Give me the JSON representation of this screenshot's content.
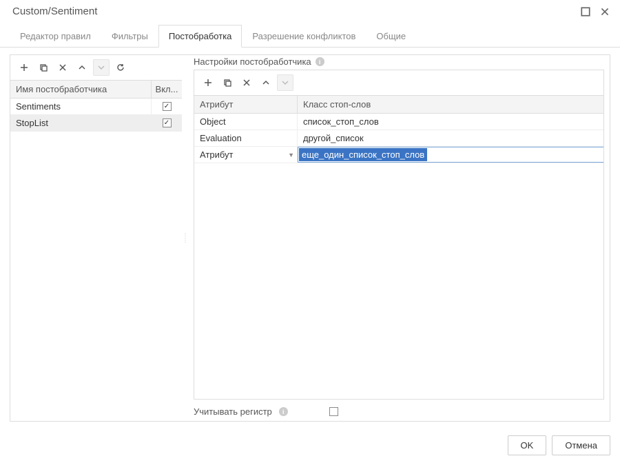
{
  "title": "Custom/Sentiment",
  "tabs": [
    {
      "label": "Редактор правил",
      "active": false
    },
    {
      "label": "Фильтры",
      "active": false
    },
    {
      "label": "Постобработка",
      "active": true
    },
    {
      "label": "Разрешение конфликтов",
      "active": false
    },
    {
      "label": "Общие",
      "active": false
    }
  ],
  "left_toolbar_icons": [
    "plus",
    "copy",
    "delete",
    "up",
    "down",
    "refresh"
  ],
  "left_grid": {
    "headers": {
      "name": "Имя постобработчика",
      "enabled": "Вкл..."
    },
    "rows": [
      {
        "name": "Sentiments",
        "enabled": true,
        "selected": false
      },
      {
        "name": "StopList",
        "enabled": true,
        "selected": true
      }
    ]
  },
  "right": {
    "section_title": "Настройки постобработчика",
    "toolbar_icons": [
      "plus",
      "copy",
      "delete",
      "up",
      "down"
    ],
    "grid": {
      "headers": {
        "attr": "Атрибут",
        "class": "Класс стоп-слов"
      },
      "rows": [
        {
          "attr": "Object",
          "class_": "список_стоп_слов",
          "editing": false
        },
        {
          "attr": "Evaluation",
          "class_": "другой_список",
          "editing": false
        },
        {
          "attr": "Атрибут",
          "class_": "еще_один_список_стоп_слов",
          "editing": true,
          "dropdown": true
        }
      ]
    },
    "case_label": "Учитывать регистр",
    "case_checked": false
  },
  "buttons": {
    "ok": "OK",
    "cancel": "Отмена"
  }
}
